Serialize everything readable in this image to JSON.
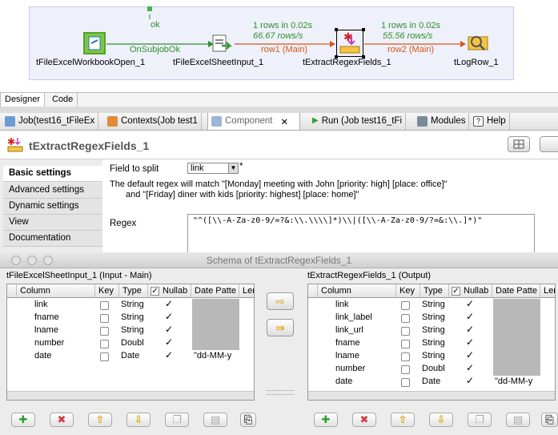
{
  "designer": {
    "link_ok_label": "ok",
    "link_onsubjobok_label": "OnSubjobOk",
    "stat1": {
      "rows": "1 rows in 0.02s",
      "rate": "66.67 rows/s",
      "row": "row1 (Main)"
    },
    "stat2": {
      "rows": "1 rows in 0.02s",
      "rate": "55.56 rows/s",
      "row": "row2 (Main)"
    },
    "nodes": [
      {
        "label": "tFileExcelWorkbookOpen_1"
      },
      {
        "label": "tFileExcelSheetInput_1"
      },
      {
        "label": "tExtractRegexFields_1"
      },
      {
        "label": "tLogRow_1"
      }
    ],
    "tabs": [
      "Designer",
      "Code"
    ]
  },
  "view_tabs": [
    {
      "label": "Job(test16_tFileEx"
    },
    {
      "label": "Contexts(Job test1"
    },
    {
      "label": "Component"
    },
    {
      "label": "Run (Job test16_tFi"
    },
    {
      "label": "Modules"
    },
    {
      "label": "Help"
    }
  ],
  "component": {
    "name": "tExtractRegexFields_1",
    "side_tabs": [
      "Basic settings",
      "Advanced settings",
      "Dynamic settings",
      "View",
      "Documentation"
    ],
    "field_to_split_label": "Field to split",
    "field_to_split_value": "link",
    "asterisk": "*",
    "help_line1": "The default regex will match \"[Monday] meeting with John [priority: high] [place: office]\"",
    "help_line2": "and \"[Friday] diner with kids [priority: highest] [place: home]\"",
    "regex_label": "Regex",
    "regex_value": "\"^([\\\\-A-Za-z0-9/=?&:\\\\.\\\\\\\\]*)\\\\|([\\\\-A-Za-z0-9/?=&:\\\\.]*)\""
  },
  "schema_dialog": {
    "title": "Schema of tExtractRegexFields_1",
    "input_title": "tFileExcelSheetInput_1 (Input - Main)",
    "output_title": "tExtractRegexFields_1 (Output)",
    "headers": [
      "Column",
      "Key",
      "Type",
      "Nullab",
      "Date Patte",
      "Ler"
    ],
    "input_rows": [
      {
        "column": "link",
        "type": "String",
        "pattern": ""
      },
      {
        "column": "fname",
        "type": "String",
        "pattern": ""
      },
      {
        "column": "lname",
        "type": "String",
        "pattern": ""
      },
      {
        "column": "number",
        "type": "Doubl",
        "pattern": ""
      },
      {
        "column": "date",
        "type": "Date",
        "pattern": "\"dd-MM-y"
      }
    ],
    "output_rows": [
      {
        "column": "link",
        "type": "String",
        "pattern": ""
      },
      {
        "column": "link_label",
        "type": "String",
        "pattern": ""
      },
      {
        "column": "link_url",
        "type": "String",
        "pattern": ""
      },
      {
        "column": "fname",
        "type": "String",
        "pattern": ""
      },
      {
        "column": "lname",
        "type": "String",
        "pattern": ""
      },
      {
        "column": "number",
        "type": "Doubl",
        "pattern": ""
      },
      {
        "column": "date",
        "type": "Date",
        "pattern": "\"dd-MM-y"
      }
    ]
  }
}
